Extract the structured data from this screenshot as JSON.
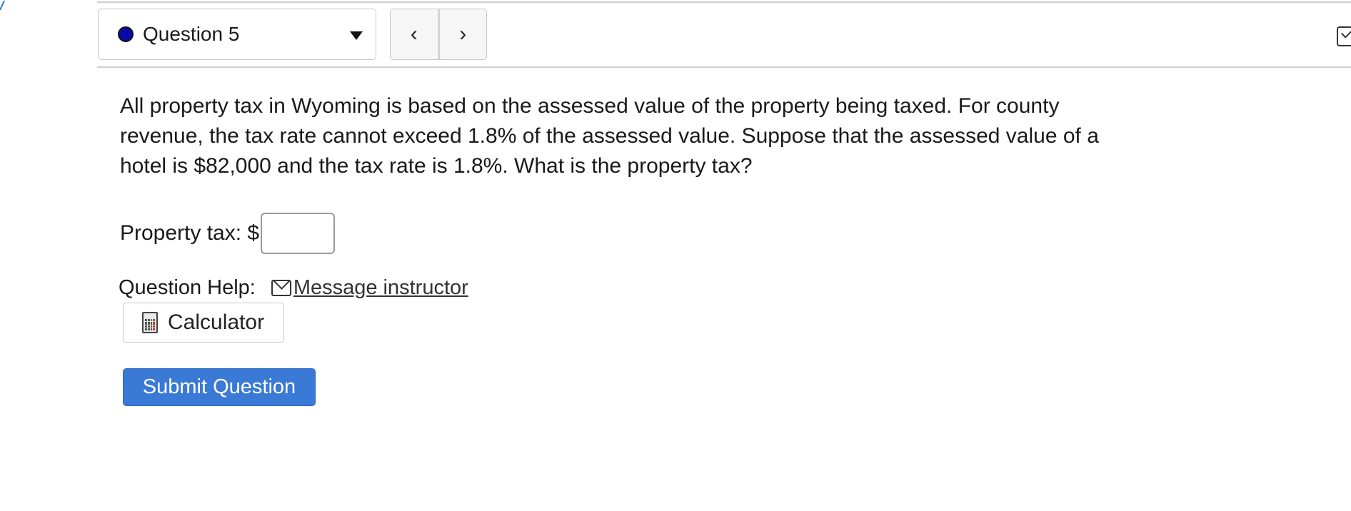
{
  "header": {
    "question_selector": {
      "label": "Question 5",
      "status_color": "#0a0aa8"
    },
    "nav": {
      "prev_glyph": "‹",
      "next_glyph": "›"
    }
  },
  "question": {
    "text": "All property tax in Wyoming is based on the assessed value of the property being taxed. For county revenue, the tax rate cannot exceed 1.8% of the assessed value. Suppose that the assessed value of a hotel is $82,000 and the tax rate is 1.8%. What is the property tax?"
  },
  "answer": {
    "label": "Property tax: $",
    "value": ""
  },
  "help": {
    "label": "Question Help:",
    "message_link": "Message instructor",
    "calculator_label": "Calculator"
  },
  "submit": {
    "label": "Submit Question"
  },
  "colors": {
    "submit_bg": "#3a79d6",
    "accent_edge": "#3a6fd8"
  }
}
